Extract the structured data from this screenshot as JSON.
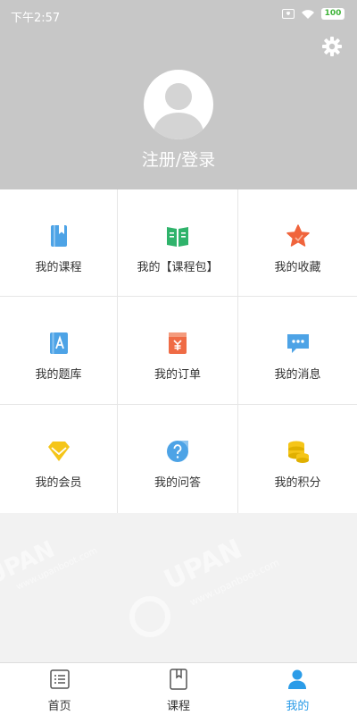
{
  "status_bar": {
    "time": "下午2:57",
    "battery": "100"
  },
  "header": {
    "login_label": "注册/登录"
  },
  "grid": {
    "items": [
      {
        "label": "我的课程",
        "icon": "book-icon",
        "color": "#4da3e6"
      },
      {
        "label": "我的【课程包】",
        "icon": "open-book-icon",
        "color": "#2fb36b"
      },
      {
        "label": "我的收藏",
        "icon": "star-icon",
        "color": "#f0643c"
      },
      {
        "label": "我的题库",
        "icon": "question-bank-icon",
        "color": "#4da3e6"
      },
      {
        "label": "我的订单",
        "icon": "order-icon",
        "color": "#ef6b45"
      },
      {
        "label": "我的消息",
        "icon": "message-icon",
        "color": "#4da3e6"
      },
      {
        "label": "我的会员",
        "icon": "diamond-icon",
        "color": "#f5c518"
      },
      {
        "label": "我的问答",
        "icon": "qa-icon",
        "color": "#4da3e6"
      },
      {
        "label": "我的积分",
        "icon": "coins-icon",
        "color": "#f5c518"
      }
    ]
  },
  "watermark": {
    "brand": "UPAN",
    "url": "www.upanboot.com"
  },
  "tabbar": {
    "tabs": [
      {
        "label": "首页",
        "icon": "home-list-icon"
      },
      {
        "label": "课程",
        "icon": "course-book-icon"
      },
      {
        "label": "我的",
        "icon": "user-icon",
        "active": true
      }
    ],
    "active_color": "#2b9ce8"
  }
}
